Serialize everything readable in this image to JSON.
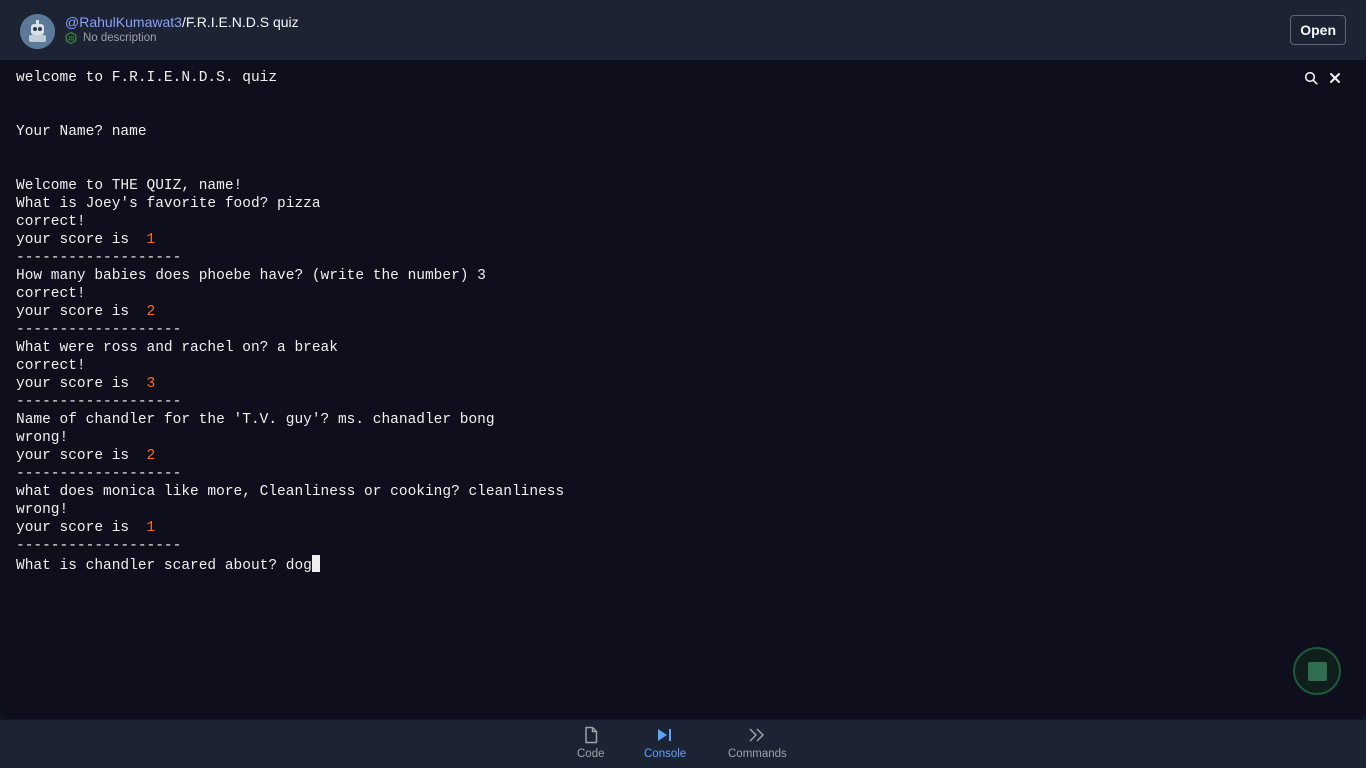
{
  "header": {
    "owner": "@RahulKumawat3",
    "separator": "/",
    "repl_name": "F.R.I.E.N.D.S quiz",
    "description": "No description",
    "open_label": "Open"
  },
  "console": {
    "lines": [
      {
        "text": "welcome to F.R.I.E.N.D.S. quiz"
      },
      {
        "text": ""
      },
      {
        "text": ""
      },
      {
        "text": "Your Name? name"
      },
      {
        "text": ""
      },
      {
        "text": ""
      },
      {
        "text": "Welcome to THE QUIZ, name!"
      },
      {
        "text": "What is Joey's favorite food? pizza"
      },
      {
        "text": "correct!"
      },
      {
        "text": "your score is  ",
        "score": "1"
      },
      {
        "text": "-------------------"
      },
      {
        "text": "How many babies does phoebe have? (write the number) 3"
      },
      {
        "text": "correct!"
      },
      {
        "text": "your score is  ",
        "score": "2"
      },
      {
        "text": "-------------------"
      },
      {
        "text": "What were ross and rachel on? a break"
      },
      {
        "text": "correct!"
      },
      {
        "text": "your score is  ",
        "score": "3"
      },
      {
        "text": "-------------------"
      },
      {
        "text": "Name of chandler for the 'T.V. guy'? ms. chanadler bong"
      },
      {
        "text": "wrong!"
      },
      {
        "text": "your score is  ",
        "score": "2"
      },
      {
        "text": "-------------------"
      },
      {
        "text": "what does monica like more, Cleanliness or cooking? cleanliness"
      },
      {
        "text": "wrong!"
      },
      {
        "text": "your score is  ",
        "score": "1"
      },
      {
        "text": "-------------------"
      },
      {
        "text": "What is chandler scared about? dog",
        "cursor": true
      }
    ],
    "score_color": "#ff6b1a"
  },
  "icons": {
    "search": "search-icon",
    "close": "close-icon",
    "stop": "stop-icon"
  },
  "nav": {
    "items": [
      {
        "label": "Code",
        "icon": "file-icon",
        "active": false
      },
      {
        "label": "Console",
        "icon": "play-step-icon",
        "active": true
      },
      {
        "label": "Commands",
        "icon": "double-chevron-icon",
        "active": false
      }
    ],
    "active_color": "#5ba4ff"
  }
}
